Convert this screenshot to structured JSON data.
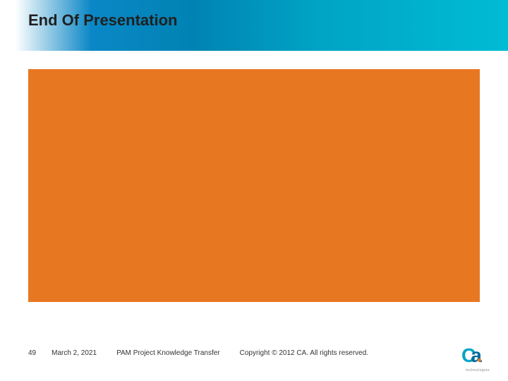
{
  "slide": {
    "title": "End Of Presentation"
  },
  "footer": {
    "page_number": "49",
    "date": "March 2, 2021",
    "project": "PAM Project Knowledge Transfer",
    "copyright": "Copyright © 2012 CA. All rights reserved."
  },
  "logo": {
    "text_c": "C",
    "text_a": "a",
    "sub": "technologies"
  },
  "colors": {
    "accent": "#e87722",
    "gradient_start": "#ffffff",
    "gradient_mid": "#0083b3",
    "gradient_end": "#00bcd4"
  }
}
